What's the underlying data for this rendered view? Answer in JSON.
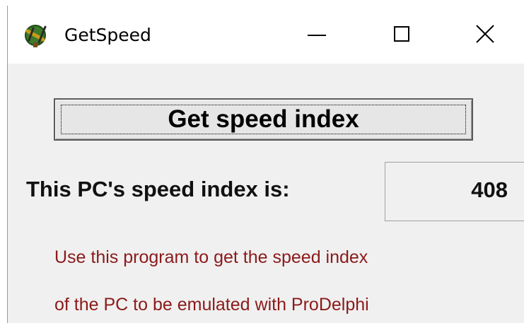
{
  "window": {
    "title": "GetSpeed",
    "icon": "prodelphi-app-icon",
    "controls": {
      "minimize_icon": "minimize-icon",
      "maximize_icon": "maximize-icon",
      "close_icon": "close-icon"
    }
  },
  "main": {
    "button_label": "Get speed index",
    "result_label": "This PC's speed index is:",
    "result_value": "408",
    "info_lines": [
      "Use this program to get the speed index",
      "of the PC to be emulated with ProDelphi"
    ]
  },
  "colors": {
    "info_text": "#8b1a1a",
    "window_background": "#f0f0f0",
    "titlebar_background": "#ffffff"
  }
}
